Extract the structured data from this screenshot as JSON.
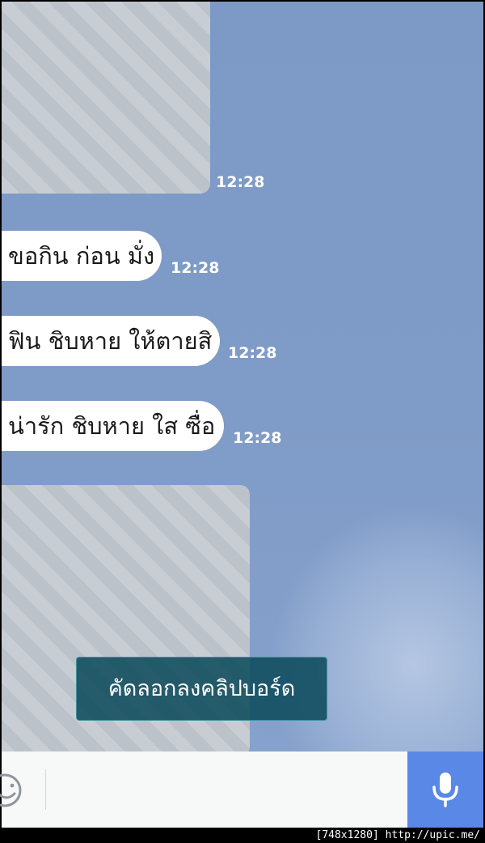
{
  "chat": {
    "messages": [
      {
        "type": "image",
        "time": "12:28"
      },
      {
        "type": "text",
        "text": "ขอกิน ก่อน มั่ง",
        "time": "12:28"
      },
      {
        "type": "text",
        "text": "ฟิน ชิบหาย ให้ตายสิ",
        "time": "12:28"
      },
      {
        "type": "text",
        "text": "น่ารัก ชิบหาย ใส ซื่อ",
        "time": "12:28"
      },
      {
        "type": "image",
        "time": ""
      }
    ]
  },
  "toast": {
    "text": "คัดลอกลงคลิปบอร์ด"
  },
  "input_bar": {
    "value": "",
    "placeholder": "",
    "icons": [
      "emoji-icon",
      "microphone-icon"
    ],
    "mic_color": "#5a88e6"
  },
  "watermark": {
    "text": "[748x1280] http://upic.me/"
  },
  "colors": {
    "chat_background": "#7f9bc7",
    "bubble": "#ffffff",
    "toast": "#0e4b5c"
  }
}
